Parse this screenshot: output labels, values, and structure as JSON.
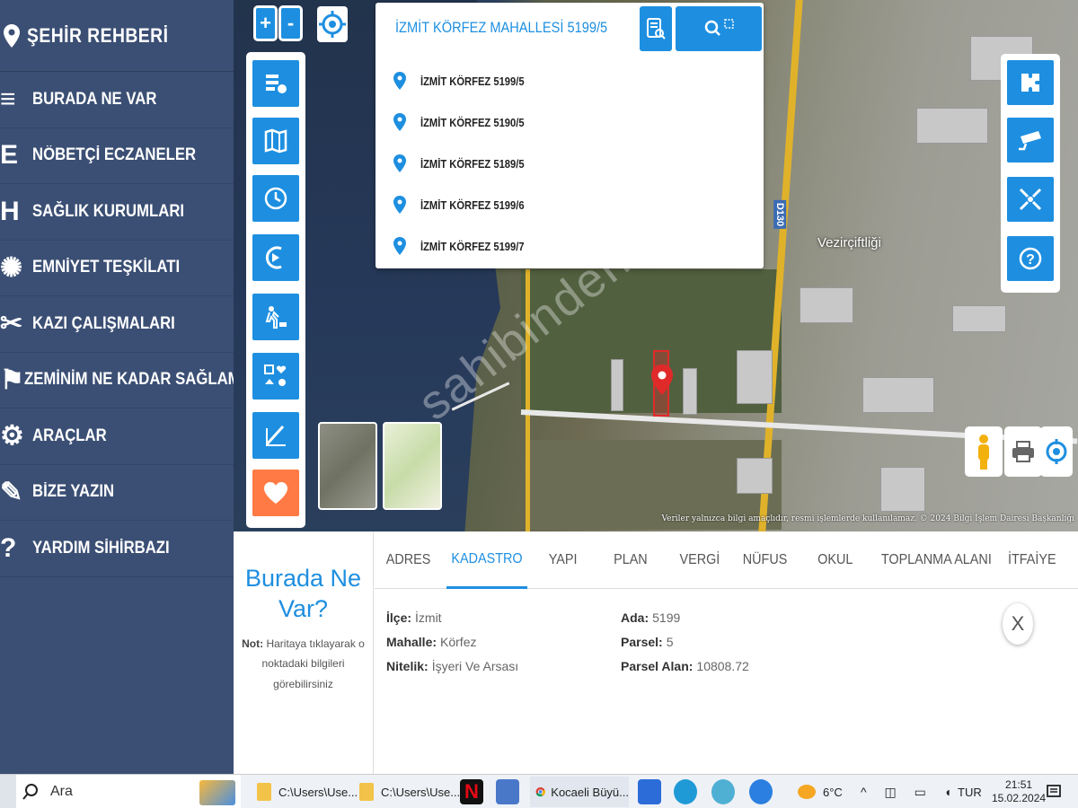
{
  "sidebar": {
    "title": "ŞEHİR REHBERİ",
    "items": [
      {
        "label": "BURADA NE VAR",
        "icon": "list-icon",
        "glyph": "≡"
      },
      {
        "label": "NÖBETÇİ ECZANELER",
        "icon": "pharmacy-icon",
        "glyph": "E"
      },
      {
        "label": "SAĞLIK KURUMLARI",
        "icon": "hospital-icon",
        "glyph": "H"
      },
      {
        "label": "EMNİYET TEŞKİLATI",
        "icon": "police-badge-icon",
        "glyph": "✺"
      },
      {
        "label": "KAZI ÇALIŞMALARI",
        "icon": "tools-icon",
        "glyph": "✂"
      },
      {
        "label": "ZEMİNİM NE KADAR SAĞLAM",
        "icon": "ground-icon",
        "glyph": "⚑"
      },
      {
        "label": "ARAÇLAR",
        "icon": "gear-icon",
        "glyph": "⚙"
      },
      {
        "label": "BİZE YAZIN",
        "icon": "chat-icon",
        "glyph": "✎"
      },
      {
        "label": "YARDIM SİHİRBAZI",
        "icon": "help-icon",
        "glyph": "?"
      }
    ]
  },
  "map": {
    "zoom_in": "+",
    "zoom_out": "-",
    "place_label": "Vezirçiftliği",
    "road_label": "D130",
    "watermark": "sahibinden.com",
    "credit": "Veriler yalnızca bilgi amaçlıdır, resmi işlemlerde kullanılamaz. © 2024 Bilgi İşlem Dairesi Başkanlığı",
    "left_tools": [
      "layers-info-icon",
      "map-icon",
      "time-icon",
      "compass-icon",
      "construction-icon",
      "emergency-icon",
      "measure-icon",
      "favorite-icon"
    ],
    "right_tools": [
      "puzzle-icon",
      "camera-icon",
      "collapse-icon",
      "question-icon"
    ]
  },
  "search": {
    "value": "İZMİT KÖRFEZ MAHALLESİ 5199/5",
    "suggestions": [
      "İZMİT KÖRFEZ 5199/5",
      "İZMİT KÖRFEZ 5190/5",
      "İZMİT KÖRFEZ 5189/5",
      "İZMİT KÖRFEZ 5199/6",
      "İZMİT KÖRFEZ 5199/7"
    ]
  },
  "info_panel": {
    "title_line1": "Burada Ne",
    "title_line2": "Var?",
    "note_label": "Not:",
    "note_text": "Haritaya tıklayarak o noktadaki bilgileri görebilirsiniz",
    "tabs": [
      "ADRES",
      "KADASTRO",
      "YAPI",
      "PLAN",
      "VERGİ",
      "NÜFUS",
      "OKUL",
      "TOPLANMA ALANI",
      "İTFAİYE"
    ],
    "active_tab": "KADASTRO",
    "fields_left": [
      {
        "label": "İlçe:",
        "value": "İzmit"
      },
      {
        "label": "Mahalle:",
        "value": "Körfez"
      },
      {
        "label": "Nitelik:",
        "value": "İşyeri Ve Arsası"
      }
    ],
    "fields_right": [
      {
        "label": "Ada:",
        "value": "5199"
      },
      {
        "label": "Parsel:",
        "value": "5"
      },
      {
        "label": "Parsel Alan:",
        "value": "10808.72"
      }
    ],
    "close": "X"
  },
  "taskbar": {
    "search_text": "Ara",
    "apps": [
      {
        "label": "C:\\Users\\Use...",
        "icon": "folder-icon"
      },
      {
        "label": "C:\\Users\\Use...",
        "icon": "folder-icon"
      },
      {
        "label": "Kocaeli Büyü...",
        "icon": "chrome-icon"
      }
    ],
    "weather": "6°C",
    "language": "TUR",
    "time": "21:51",
    "date": "15.02.2024"
  },
  "colors": {
    "sidebar": "#3b4f74",
    "accent": "#1e8fe0",
    "favorite": "#ff7a45"
  }
}
